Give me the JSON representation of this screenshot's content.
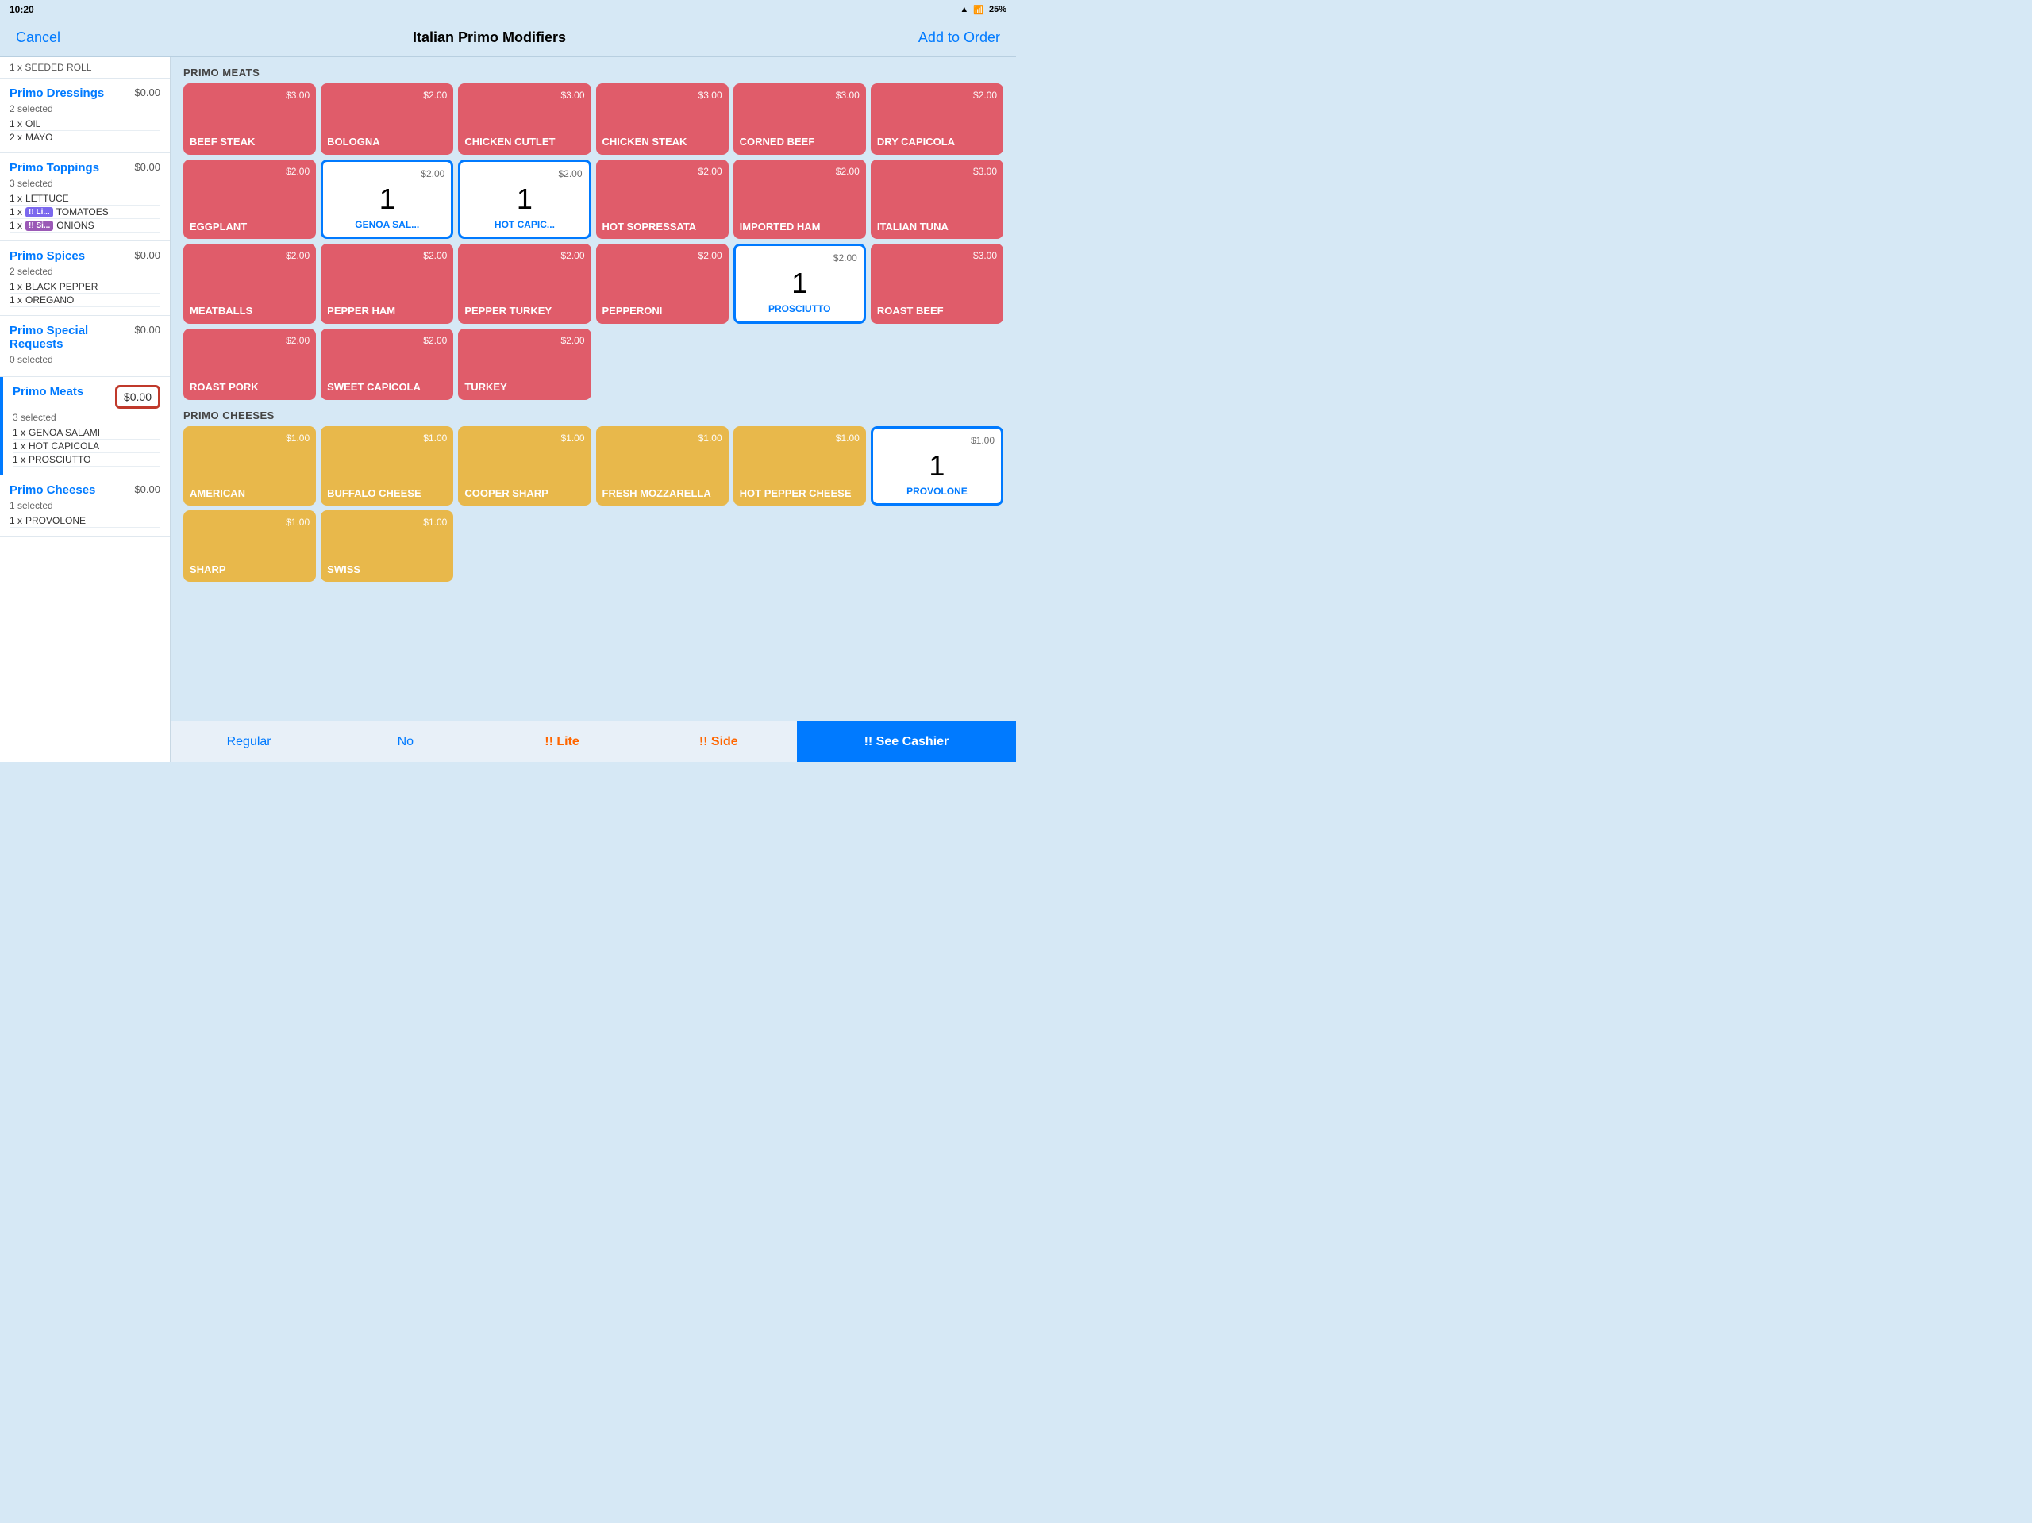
{
  "statusBar": {
    "time": "10:20",
    "signal": "▲",
    "wifi": "wifi",
    "battery": "25%"
  },
  "header": {
    "cancel": "Cancel",
    "title": "Italian Primo Modifiers",
    "addToOrder": "Add to Order"
  },
  "sidebar": {
    "scrolledItem": "1 x  SEEDED ROLL",
    "sections": [
      {
        "name": "Primo Dressings",
        "selected": "2 selected",
        "price": "$0.00",
        "items": [
          {
            "qty": "1 x",
            "tag": null,
            "label": "OIL"
          },
          {
            "qty": "2 x",
            "tag": null,
            "label": "MAYO"
          }
        ]
      },
      {
        "name": "Primo Toppings",
        "selected": "3 selected",
        "price": "$0.00",
        "items": [
          {
            "qty": "1 x",
            "tag": null,
            "label": "LETTUCE"
          },
          {
            "qty": "1 x",
            "tag": "li",
            "label": "TOMATOES"
          },
          {
            "qty": "1 x",
            "tag": "si",
            "label": "ONIONS"
          }
        ]
      },
      {
        "name": "Primo Spices",
        "selected": "2 selected",
        "price": "$0.00",
        "items": [
          {
            "qty": "1 x",
            "tag": null,
            "label": "BLACK PEPPER"
          },
          {
            "qty": "1 x",
            "tag": null,
            "label": "OREGANO"
          }
        ]
      },
      {
        "name": "Primo Special Requests",
        "selected": "0 selected",
        "price": "$0.00",
        "items": []
      },
      {
        "name": "Primo Meats",
        "selected": "3 selected",
        "price": "$0.00",
        "active": true,
        "priceBoxRed": true,
        "items": [
          {
            "qty": "1 x",
            "tag": null,
            "label": "GENOA SALAMI"
          },
          {
            "qty": "1 x",
            "tag": null,
            "label": "HOT CAPICOLA"
          },
          {
            "qty": "1 x",
            "tag": null,
            "label": "PROSCIUTTO"
          }
        ]
      },
      {
        "name": "Primo Cheeses",
        "selected": "1 selected",
        "price": "$0.00",
        "items": [
          {
            "qty": "1 x",
            "tag": null,
            "label": "PROVOLONE"
          }
        ]
      }
    ]
  },
  "primoMeats": {
    "sectionLabel": "PRIMO MEATS",
    "tiles": [
      {
        "price": "$3.00",
        "name": "BEEF STEAK",
        "type": "red",
        "count": null
      },
      {
        "price": "$2.00",
        "name": "BOLOGNA",
        "type": "red",
        "count": null
      },
      {
        "price": "$3.00",
        "name": "CHICKEN CUTLET",
        "type": "red",
        "count": null
      },
      {
        "price": "$3.00",
        "name": "CHICKEN STEAK",
        "type": "red",
        "count": null
      },
      {
        "price": "$3.00",
        "name": "CORNED BEEF",
        "type": "red",
        "count": null
      },
      {
        "price": "$2.00",
        "name": "DRY CAPICOLA",
        "type": "red",
        "count": null
      },
      {
        "price": "$2.00",
        "name": "EGGPLANT",
        "type": "red",
        "count": null
      },
      {
        "price": "$2.00",
        "name": "GENOA SAL...",
        "type": "selected-white",
        "count": "1"
      },
      {
        "price": "$2.00",
        "name": "HOT CAPIC...",
        "type": "selected-white",
        "count": "1"
      },
      {
        "price": "$2.00",
        "name": "HOT SOPRESSATA",
        "type": "red",
        "count": null
      },
      {
        "price": "$2.00",
        "name": "IMPORTED HAM",
        "type": "red",
        "count": null
      },
      {
        "price": "$3.00",
        "name": "ITALIAN TUNA",
        "type": "red",
        "count": null
      },
      {
        "price": "$2.00",
        "name": "MEATBALLS",
        "type": "red",
        "count": null
      },
      {
        "price": "$2.00",
        "name": "PEPPER HAM",
        "type": "red",
        "count": null
      },
      {
        "price": "$2.00",
        "name": "PEPPER TURKEY",
        "type": "red",
        "count": null
      },
      {
        "price": "$2.00",
        "name": "PEPPERONI",
        "type": "red",
        "count": null
      },
      {
        "price": "$2.00",
        "name": "PROSCIUTTO",
        "type": "selected-white",
        "count": "1"
      },
      {
        "price": "$3.00",
        "name": "ROAST BEEF",
        "type": "red",
        "count": null
      },
      {
        "price": "$2.00",
        "name": "ROAST PORK",
        "type": "red",
        "count": null
      },
      {
        "price": "$2.00",
        "name": "SWEET CAPICOLA",
        "type": "red",
        "count": null
      },
      {
        "price": "$2.00",
        "name": "TURKEY",
        "type": "red",
        "count": null
      }
    ]
  },
  "primoCheeses": {
    "sectionLabel": "PRIMO CHEESES",
    "tiles": [
      {
        "price": "$1.00",
        "name": "AMERICAN",
        "type": "yellow",
        "count": null
      },
      {
        "price": "$1.00",
        "name": "BUFFALO CHEESE",
        "type": "yellow",
        "count": null
      },
      {
        "price": "$1.00",
        "name": "COOPER SHARP",
        "type": "yellow",
        "count": null
      },
      {
        "price": "$1.00",
        "name": "FRESH MOZZARELLA",
        "type": "yellow",
        "count": null
      },
      {
        "price": "$1.00",
        "name": "HOT PEPPER CHEESE",
        "type": "yellow",
        "count": null
      },
      {
        "price": "$1.00",
        "name": "PROVOLONE",
        "type": "selected-white",
        "count": "1"
      },
      {
        "price": "$1.00",
        "name": "SHARP",
        "type": "yellow",
        "count": null
      },
      {
        "price": "$1.00",
        "name": "SWISS",
        "type": "yellow",
        "count": null
      }
    ]
  },
  "toolbar": {
    "regular": "Regular",
    "no": "No",
    "lite": "!! Lite",
    "side": "!! Side",
    "seeCashier": "!! See Cashier"
  }
}
